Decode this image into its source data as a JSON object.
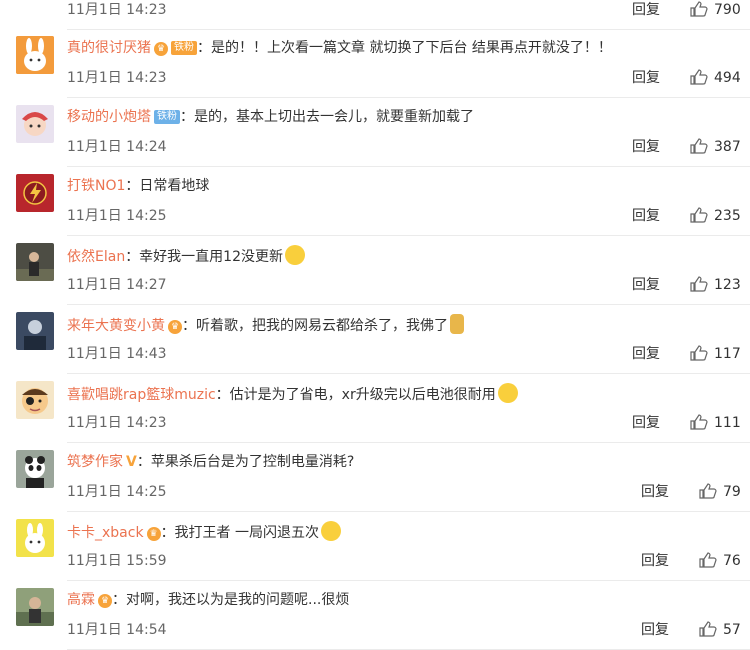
{
  "top_partial": {
    "time": "11月1日 14:23",
    "reply": "回复",
    "likes": "790"
  },
  "comments": [
    {
      "user": "真的很讨厌猪",
      "badge": "铁粉",
      "text": "：是的！！上次看一篇文章 就切换了下后台 结果再点开就没了！！",
      "time": "11月1日 14:23",
      "reply": "回复",
      "likes": "494"
    },
    {
      "user": "移动的小炮塔",
      "badge": "铁粉",
      "text": "：是的，基本上切出去一会儿，就要重新加载了",
      "time": "11月1日 14:24",
      "reply": "回复",
      "likes": "387"
    },
    {
      "user": "打铁NO1",
      "text": "：日常看地球",
      "time": "11月1日 14:25",
      "reply": "回复",
      "likes": "235"
    },
    {
      "user": "依然Elan",
      "text": "：幸好我一直用12没更新",
      "time": "11月1日 14:27",
      "reply": "回复",
      "likes": "123"
    },
    {
      "user": "来年大黄变小黄",
      "text": "：听着歌，把我的网易云都给杀了，我佛了",
      "time": "11月1日 14:43",
      "reply": "回复",
      "likes": "117"
    },
    {
      "user": "喜歡唱跳rap籃球muzic",
      "text": "：估计是为了省电，xr升级完以后电池很耐用",
      "time": "11月1日 14:23",
      "reply": "回复",
      "likes": "111"
    },
    {
      "user": "筑梦作家",
      "text": "：苹果杀后台是为了控制电量消耗?",
      "time": "11月1日 14:25",
      "reply": "回复",
      "likes": "79"
    },
    {
      "user": "卡卡_xback",
      "text": "：我打王者 一局闪退五次",
      "time": "11月1日 15:59",
      "reply": "回复",
      "likes": "76"
    },
    {
      "user": "高霖",
      "text": "：对啊，我还以为是我的问题呢...很烦",
      "time": "11月1日 14:54",
      "reply": "回复",
      "likes": "57"
    }
  ]
}
